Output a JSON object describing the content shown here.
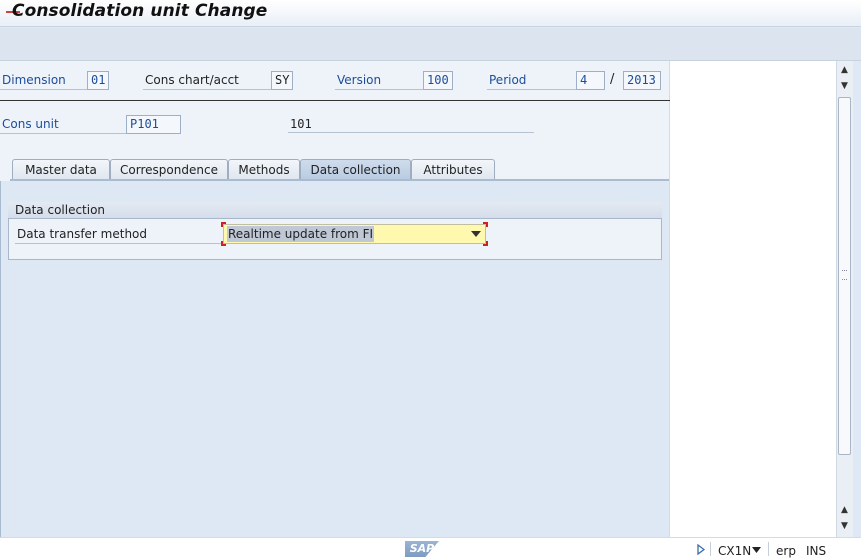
{
  "window": {
    "title": "Consolidation unit Change"
  },
  "header": {
    "dimension": {
      "label": "Dimension",
      "value": "01"
    },
    "cons_chart": {
      "label": "Cons chart/acct",
      "value": "SY"
    },
    "version": {
      "label": "Version",
      "value": "100"
    },
    "period": {
      "label": "Period",
      "value": "4",
      "separator": "/",
      "year": "2013"
    },
    "cons_unit": {
      "label": "Cons unit",
      "value": "P101",
      "description": "101"
    }
  },
  "tabs": [
    {
      "label": "Master data",
      "active": false
    },
    {
      "label": "Correspondence",
      "active": false
    },
    {
      "label": "Methods",
      "active": false
    },
    {
      "label": "Data collection",
      "active": true
    },
    {
      "label": "Attributes",
      "active": false
    }
  ],
  "group": {
    "title": "Data collection",
    "transfer_method": {
      "label": "Data transfer method",
      "value": "Realtime update from FI"
    }
  },
  "statusbar": {
    "logo": "SAP",
    "transaction": "CX1N",
    "system": "erp",
    "mode": "INS"
  },
  "colors": {
    "label_blue": "#1c4d9a",
    "dropdown_bg": "#fff9b0",
    "selection_red": "#d02020"
  },
  "icons": [
    "play-arrow-icon",
    "chevron-down-icon",
    "scroll-up-icon",
    "scroll-down-icon"
  ]
}
